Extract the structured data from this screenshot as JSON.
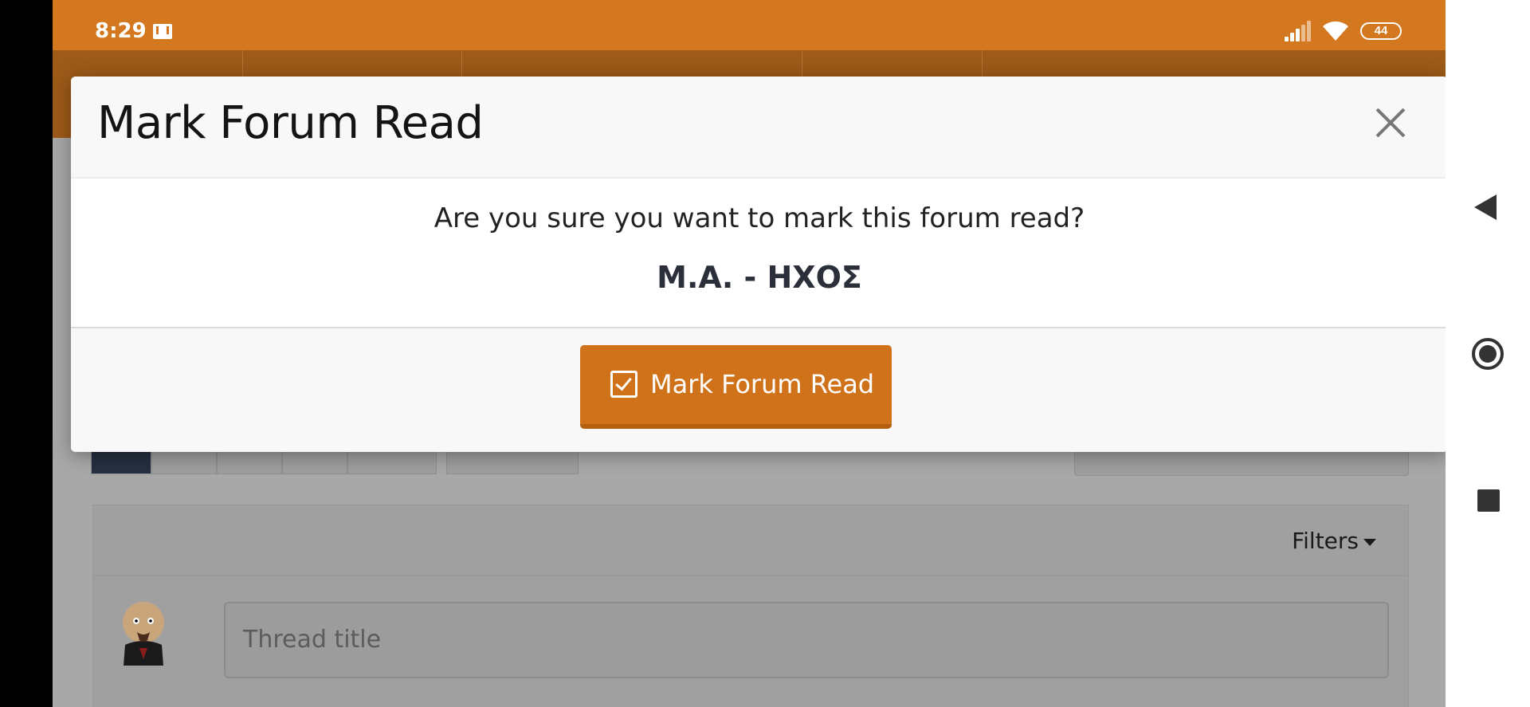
{
  "status_bar": {
    "time": "8:29",
    "battery": "44",
    "icons": [
      "mail-icon",
      "signal-icon",
      "wifi-icon",
      "battery-icon"
    ],
    "color": "#d4781f"
  },
  "modal": {
    "title": "Mark Forum Read",
    "question": "Are you sure you want to mark this forum read?",
    "forum_name": "Μ.Α. - ΗΧΟΣ",
    "confirm_label": "Mark Forum Read",
    "confirm_color": "#d0721a"
  },
  "background": {
    "filters_label": "Filters",
    "thread_title_placeholder": "Thread title"
  },
  "nav_bar": {
    "icons": [
      "back-icon",
      "home-icon",
      "recents-icon"
    ]
  }
}
